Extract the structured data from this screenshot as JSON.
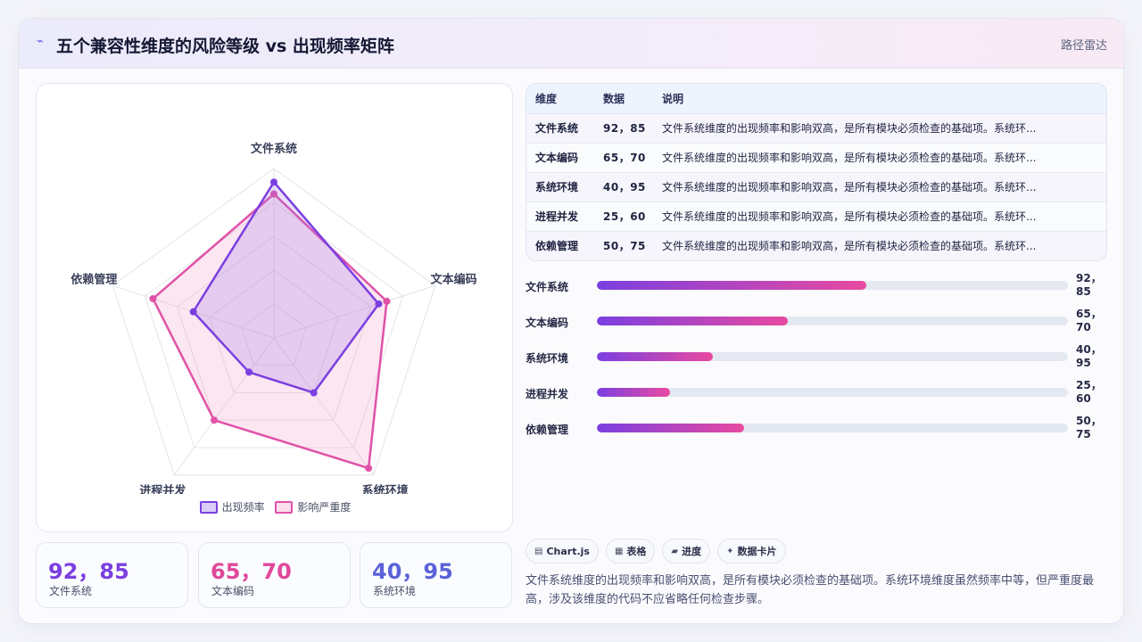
{
  "header": {
    "title": "五个兼容性维度的风险等级 vs 出现频率矩阵",
    "badge": "路径雷达"
  },
  "colors": {
    "series_frequency": "#7b3fe0",
    "series_severity": "#e052a8"
  },
  "chart_data": {
    "type": "radar",
    "categories": [
      "文件系统",
      "文本编码",
      "系统环境",
      "进程并发",
      "依赖管理"
    ],
    "series": [
      {
        "name": "出现频率",
        "values": [
          92,
          65,
          40,
          25,
          50
        ]
      },
      {
        "name": "影响严重度",
        "values": [
          85,
          70,
          95,
          60,
          75
        ]
      }
    ],
    "rlim": [
      0,
      100
    ],
    "grid": true,
    "legend": "bottom"
  },
  "table": {
    "headers": [
      "维度",
      "数据",
      "说明"
    ],
    "rows": [
      {
        "dim": "文件系统",
        "data": "92，85",
        "desc": "文件系统维度的出现频率和影响双高，是所有模块必须检查的基础项。系统环..."
      },
      {
        "dim": "文本编码",
        "data": "65，70",
        "desc": "文件系统维度的出现频率和影响双高，是所有模块必须检查的基础项。系统环..."
      },
      {
        "dim": "系统环境",
        "data": "40，95",
        "desc": "文件系统维度的出现频率和影响双高，是所有模块必须检查的基础项。系统环..."
      },
      {
        "dim": "进程并发",
        "data": "25，60",
        "desc": "文件系统维度的出现频率和影响双高，是所有模块必须检查的基础项。系统环..."
      },
      {
        "dim": "依赖管理",
        "data": "50，75",
        "desc": "文件系统维度的出现频率和影响双高，是所有模块必须检查的基础项。系统环..."
      }
    ]
  },
  "progress": [
    {
      "label": "文件系统",
      "value": "92，85",
      "percent": 57.2
    },
    {
      "label": "文本编码",
      "value": "65，70",
      "percent": 40.5
    },
    {
      "label": "系统环境",
      "value": "40，95",
      "percent": 24.6
    },
    {
      "label": "进程并发",
      "value": "25，60",
      "percent": 15.5
    },
    {
      "label": "依赖管理",
      "value": "50，75",
      "percent": 31.3
    }
  ],
  "stats": [
    {
      "value": "92，85",
      "label": "文件系统",
      "color": "#7b3fe0"
    },
    {
      "value": "65，70",
      "label": "文本编码",
      "color": "#e0489a"
    },
    {
      "value": "40，95",
      "label": "系统环境",
      "color": "#5b63d8"
    }
  ],
  "chips": [
    {
      "icon": "chart-icon",
      "glyph": "▤",
      "label": "Chart.js"
    },
    {
      "icon": "table-icon",
      "glyph": "▦",
      "label": "表格"
    },
    {
      "icon": "progress-icon",
      "glyph": "▰",
      "label": "进度"
    },
    {
      "icon": "card-icon",
      "glyph": "✦",
      "label": "数据卡片"
    }
  ],
  "summary": "文件系统维度的出现频率和影响双高，是所有模块必须检查的基础项。系统环境维度虽然频率中等，但严重度最高，涉及该维度的代码不应省略任何检查步骤。"
}
